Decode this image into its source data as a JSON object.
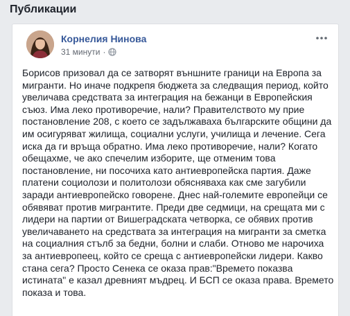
{
  "section": {
    "title": "Публикации"
  },
  "post": {
    "author": "Корнелия Нинова",
    "time": "31 минути",
    "separator": "·",
    "privacy_icon": "globe-icon",
    "more_icon": "more-options-icon",
    "text": "Борисов призовал да се затворят външните граници на Европа за\nмигранти. Но иначе подкрепя бюджета за следващия период, който\nувеличава средствата за интеграция на бежанци в Европейския\nсъюз. Има леко противоречие, нали? Правителството му прие\nпостановление 208, с което се задължаваха българските общини да\nим осигуряват жилища, социални услуги, училища и лечение. Сега\nиска да ги връща обратно. Има леко противоречие, нали? Когато\nобещахме, че ако спечелим изборите, ще отменим това\nпостановление, ни посочиха като антиевропейска партия. Даже\nплатени социолози и политолози обясняваха как сме загубили\nзаради антиевропейско говорене. Днес най-големите европейци се\nобявяват против мигрантите. Преди две седмици, на срещата ми с\nлидери на партии от Вишеградската четворка, се обявих против\nувеличаването на средствата за интеграция на мигранти за сметка\nна социалния стълб за бедни, болни и слаби. Отново ме нарочиха\nза антиевропеец, който се среща с антиевропейски лидери. Какво\nстана сега? Просто Сенека се оказа прав:\"Времето показва\nистината\" е казал древният мъдрец. И БСП се оказа права. Времето\nпоказа и това."
  },
  "colors": {
    "background": "#e9ebee",
    "card": "#ffffff",
    "author_link": "#365899",
    "text": "#1d2129",
    "meta": "#616770"
  }
}
